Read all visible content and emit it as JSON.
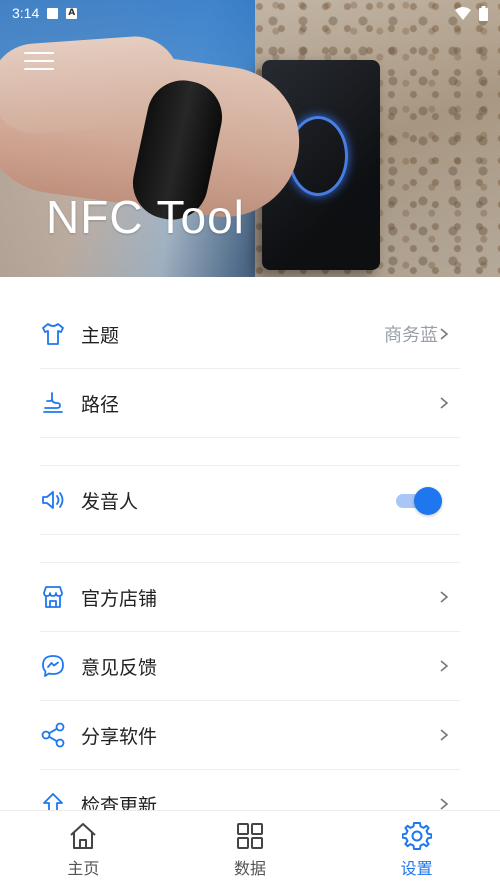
{
  "status_bar": {
    "time": "3:14",
    "notif_letter": "A"
  },
  "hero": {
    "title": "NFC Tool"
  },
  "settings": {
    "theme": {
      "label": "主题",
      "value": "商务蓝"
    },
    "path": {
      "label": "路径"
    },
    "speaker": {
      "label": "发音人",
      "enabled": true
    },
    "store": {
      "label": "官方店铺"
    },
    "feedback": {
      "label": "意见反馈"
    },
    "share": {
      "label": "分享软件"
    },
    "update": {
      "label": "检查更新"
    }
  },
  "bottom_nav": {
    "items": [
      {
        "label": "主页",
        "icon": "home-icon",
        "active": false
      },
      {
        "label": "数据",
        "icon": "grid-icon",
        "active": false
      },
      {
        "label": "设置",
        "icon": "gear-icon",
        "active": true
      }
    ]
  },
  "colors": {
    "accent": "#1f77f0",
    "toggle_track": "#a9c6f6",
    "value_text": "#9aa0a8"
  }
}
